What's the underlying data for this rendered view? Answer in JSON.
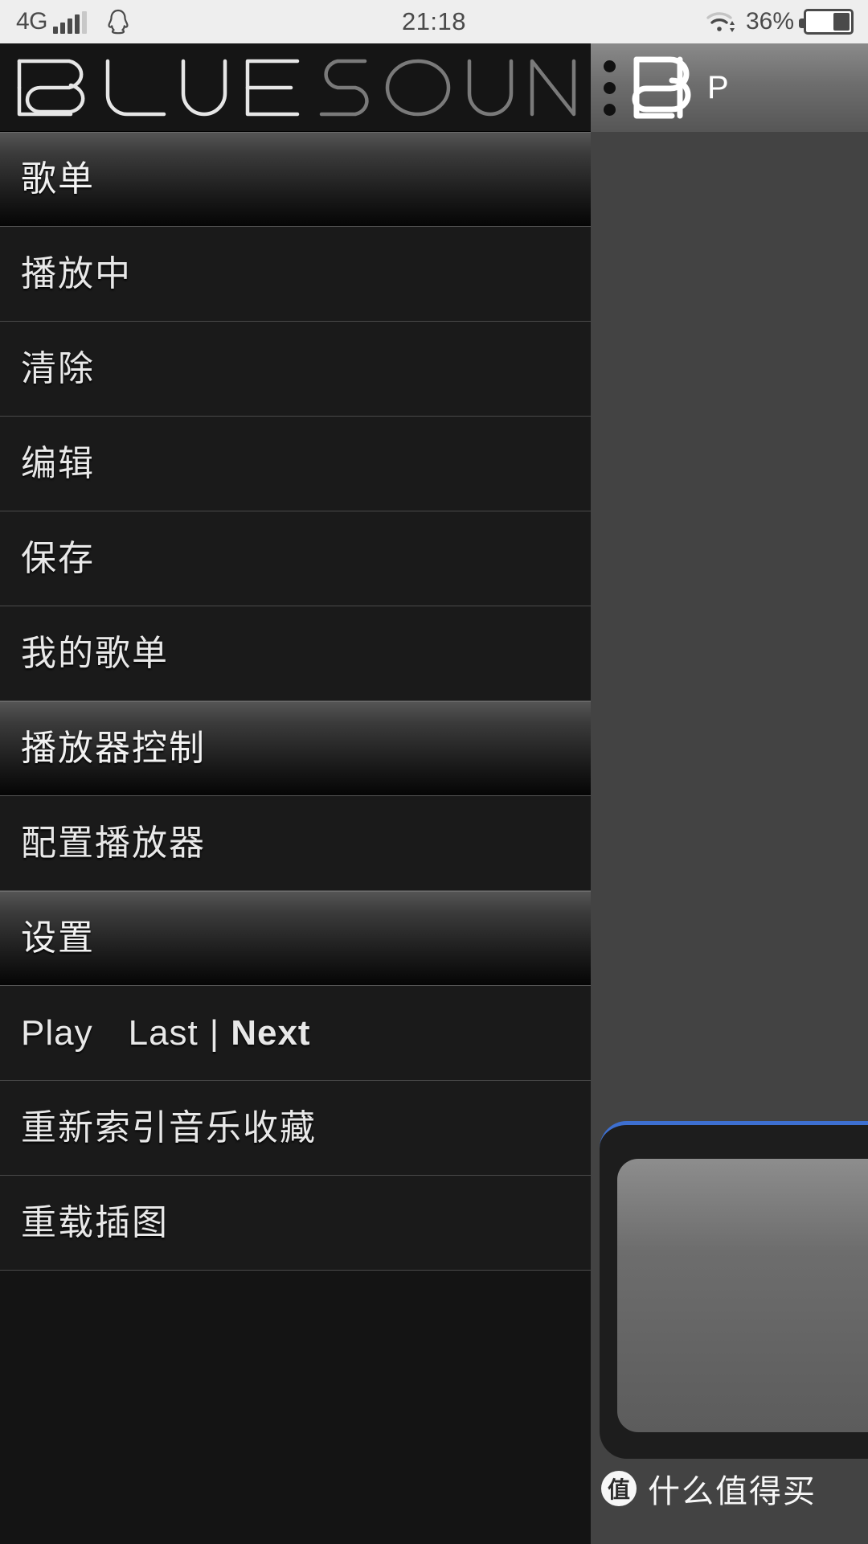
{
  "status_bar": {
    "network_label": "4G",
    "signal_icon": "signal-bars-icon",
    "qq_icon": "qq-penguin-icon",
    "time": "21:18",
    "wifi_icon": "wifi-icon",
    "battery_percent": "36%",
    "battery_icon": "battery-icon"
  },
  "drawer": {
    "logo_text": "BLUESOUND",
    "logo_primary": "BLUE",
    "logo_secondary": "SOUND",
    "rows": [
      {
        "label": "歌单",
        "type": "header"
      },
      {
        "label": "播放中",
        "type": "item"
      },
      {
        "label": "清除",
        "type": "item"
      },
      {
        "label": "编辑",
        "type": "item"
      },
      {
        "label": "保存",
        "type": "item"
      },
      {
        "label": "我的歌单",
        "type": "item"
      },
      {
        "label": "播放器控制",
        "type": "header"
      },
      {
        "label": "配置播放器",
        "type": "item"
      },
      {
        "label": "设置",
        "type": "header"
      },
      {
        "label": "",
        "type": "transport"
      },
      {
        "label": "重新索引音乐收藏",
        "type": "item"
      },
      {
        "label": "重载插图",
        "type": "item"
      }
    ],
    "transport": {
      "play": "Play",
      "last": "Last",
      "separator": "|",
      "next": "Next"
    }
  },
  "background": {
    "overflow_menu_icon": "three-dots-icon",
    "brand_mark_icon": "bluesound-b-logo-icon",
    "title": "P"
  },
  "watermark": {
    "badge": "值",
    "text": "什么值得买"
  },
  "colors": {
    "status_bar_bg": "#eeeeee",
    "status_bar_fg": "#4a4a4a",
    "drawer_bg": "#1a1a1a",
    "drawer_row_border": "#4a4a4a",
    "menu_text": "#e8e8e8",
    "background_panel": "#434343",
    "accent_blue": "#3d6fd0"
  }
}
